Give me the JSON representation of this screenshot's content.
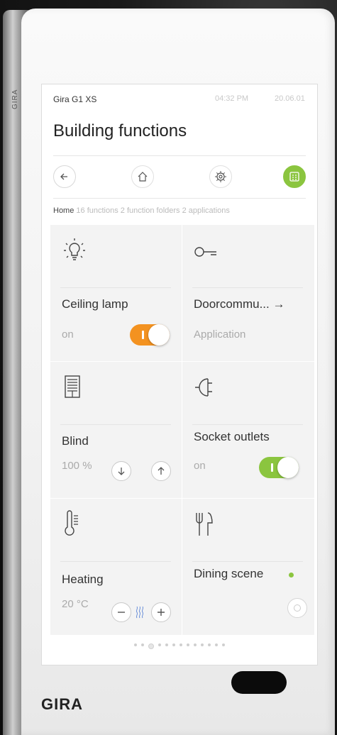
{
  "device": {
    "brand_logo": "GIRA",
    "side_logo": "GIRA"
  },
  "status": {
    "device_name": "Gira G1 XS",
    "time": "04:32 PM",
    "date": "20.06.01"
  },
  "page": {
    "title": "Building functions"
  },
  "nav": {
    "back_icon": "arrow-left-icon",
    "home_icon": "home-icon",
    "settings_icon": "gear-icon",
    "grid_icon": "grid-icon",
    "active_color": "#8bc53f"
  },
  "breadcrumb": {
    "home": "Home",
    "details": "16 functions 2 function folders 2 applications"
  },
  "tiles": {
    "ceiling_lamp": {
      "label": "Ceiling lamp",
      "state": "on",
      "icon": "bulb-icon",
      "toggle_on": true,
      "toggle_color": "#f39220"
    },
    "doorcomm": {
      "label": "Doorcommu... →",
      "sub": "Application",
      "icon": "key-icon"
    },
    "blind": {
      "label": "Blind",
      "value": "100 %",
      "icon": "blind-icon"
    },
    "socket": {
      "label": "Socket outlets",
      "state": "on",
      "icon": "socket-icon",
      "toggle_on": true,
      "toggle_color": "#8bc53f"
    },
    "heating": {
      "label": "Heating",
      "value": "20 °C",
      "icon": "thermometer-icon"
    },
    "dining": {
      "label": "Dining scene",
      "icon": "fork-knife-icon",
      "indicator_color": "#8bc53f"
    }
  },
  "pagination": {
    "count": 13,
    "active": 3
  }
}
